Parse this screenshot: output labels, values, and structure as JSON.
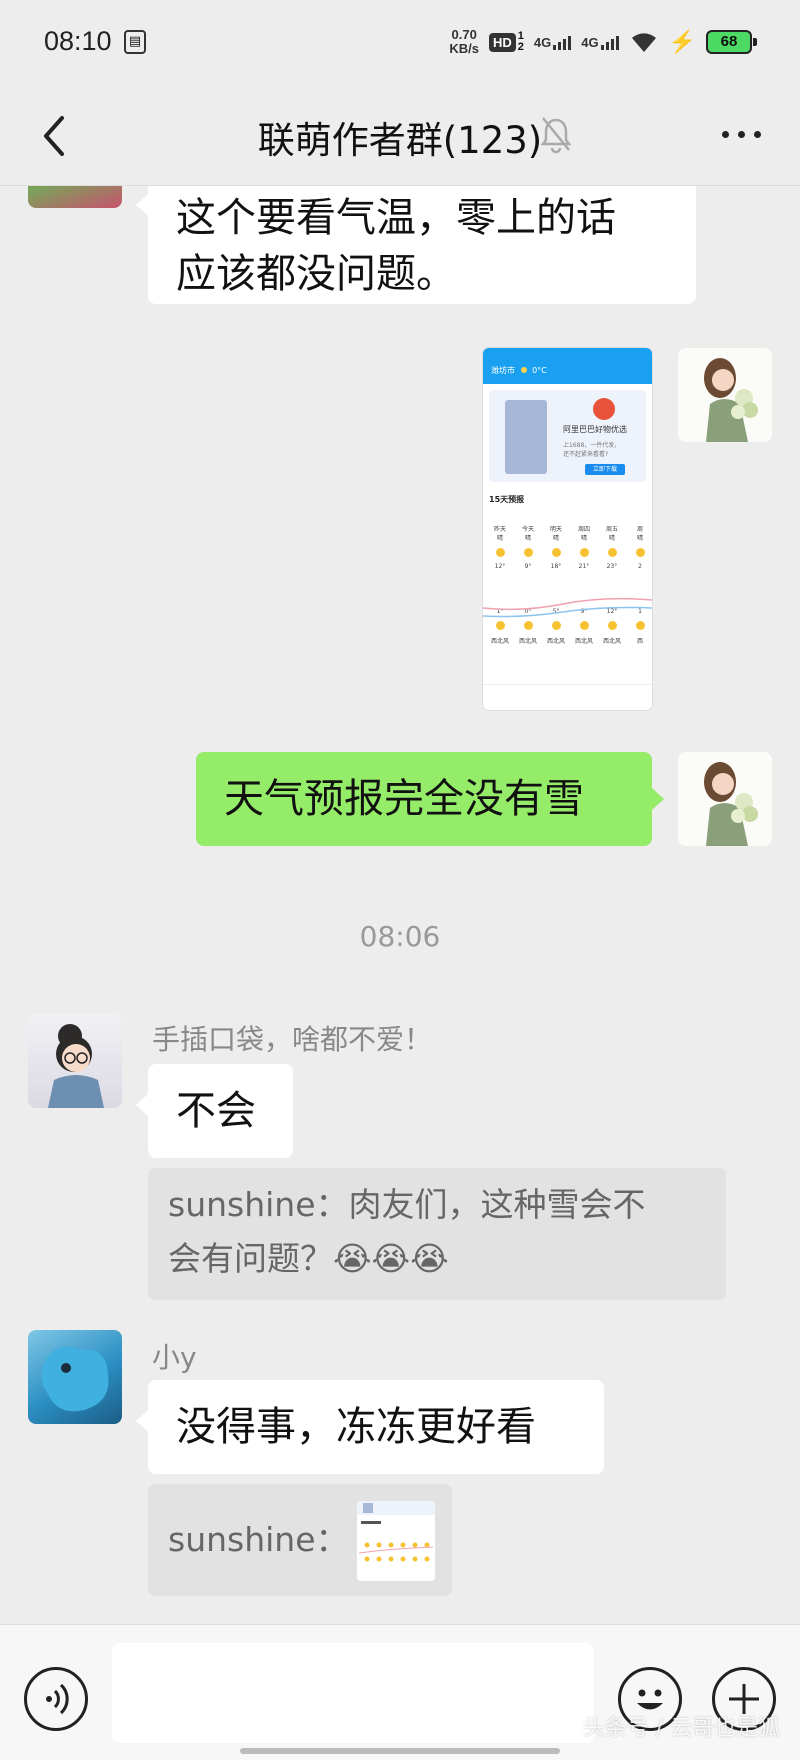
{
  "status_bar": {
    "time": "08:10",
    "notification_icon": "note-icon",
    "net_speed_value": "0.70",
    "net_speed_unit": "KB/s",
    "hd_label": "HD",
    "sim1_label": "1",
    "sim2_label": "2",
    "network1": "4G",
    "network2": "4G",
    "battery": "68",
    "battery_color": "#4cd964"
  },
  "header": {
    "title": "联萌作者群(123)",
    "muted_icon": "bell-off-icon"
  },
  "messages": {
    "m1": {
      "line1": "这个要看气温，零上的话",
      "line2": "应该都没问题。"
    },
    "m2": {
      "type": "image",
      "weather_screenshot": {
        "city": "潍坊市",
        "temp": "0°C",
        "ad_title": "阿里巴巴好物优选",
        "ad_sub1": "上1688，一件代发，",
        "ad_sub2": "还不赶紧来看看?",
        "ad_button": "立即下载",
        "forecast_title": "15天预报",
        "days": [
          "昨天",
          "今天",
          "明天",
          "周四",
          "周五",
          "周"
        ],
        "conditions": [
          "晴",
          "晴",
          "晴",
          "晴",
          "晴",
          "晴"
        ],
        "highs": [
          "12°",
          "9°",
          "18°",
          "21°",
          "23°",
          "2"
        ],
        "lows": [
          "1°",
          "0°",
          "5°",
          "9°",
          "12°",
          "1"
        ],
        "winds": [
          "西北风",
          "西北风",
          "西北风",
          "西北风",
          "西北风",
          "西"
        ]
      }
    },
    "m3": {
      "text": "天气预报完全没有雪"
    },
    "divider_time": "08:06",
    "m4": {
      "sender": "手插口袋，啥都不爱！",
      "text": "不会",
      "quote_line1": "sunshine：肉友们，这种雪会不",
      "quote_line2": "会有问题？😭😭😭"
    },
    "m5": {
      "sender": "小y",
      "text": "没得事，冻冻更好看",
      "quote_label": "sunshine："
    }
  },
  "input_bar": {
    "voice_icon": "voice-icon",
    "input_value": "",
    "emoji_icon": "emoji-icon",
    "plus_icon": "plus-icon",
    "watermark": "头条号 / 云哥也是狐"
  },
  "colors": {
    "background": "#ededed",
    "sent_bubble": "#95ec69",
    "received_bubble": "#ffffff",
    "quote_bg": "#e2e2e2"
  }
}
